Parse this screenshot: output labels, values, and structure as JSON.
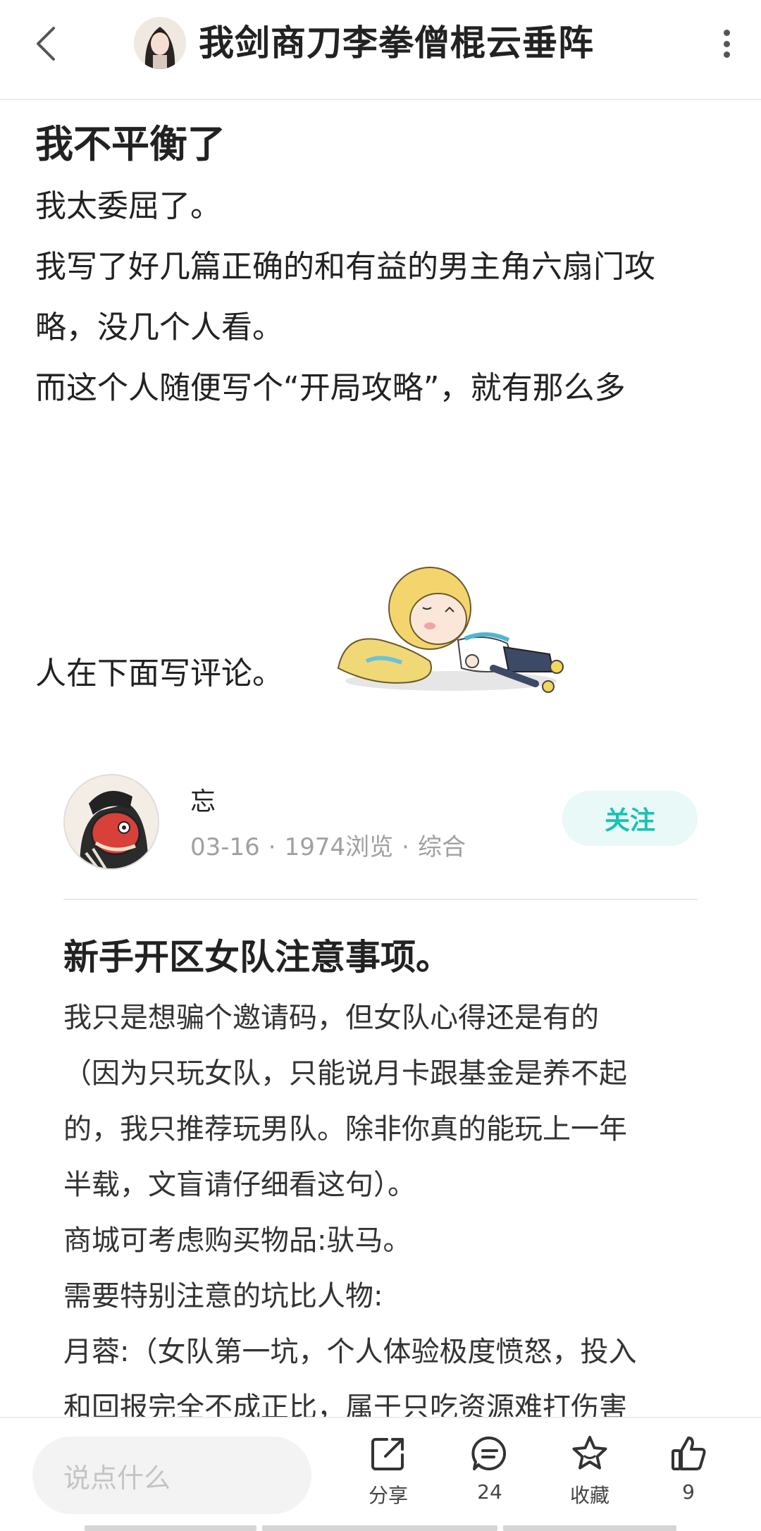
{
  "header": {
    "title": "我剑商刀李拳僧棍云垂阵"
  },
  "post": {
    "title": "我不平衡了",
    "paragraphs": [
      "我太委屈了。",
      "我写了好几篇正确的和有益的男主角六扇门攻",
      "略，没几个人看。",
      "而这个人随便写个“开局攻略”，就有那么多"
    ],
    "trailing_text": "人在下面写评论。"
  },
  "quoted_post": {
    "author": "忘",
    "date": "03-16",
    "views": "1974浏览",
    "category": "综合",
    "meta_separator": "·",
    "follow_label": "关注",
    "title": "新手开区女队注意事项。",
    "lines": [
      "我只是想骗个邀请码，但女队心得还是有的",
      "（因为只玩女队，只能说月卡跟基金是养不起",
      "的，我只推荐玩男队。除非你真的能玩上一年",
      "半载，文盲请仔细看这句）。",
      "商城可考虑购买物品:驮马。",
      "需要特别注意的坑比人物:",
      "月蓉:（女队第一坑，个人体验极度愤怒，投入",
      "和回报完全不成正比，属于只吃资源难打伤害"
    ]
  },
  "bottom_bar": {
    "comment_placeholder": "说点什么",
    "share_label": "分享",
    "comment_count": "24",
    "favorite_label": "收藏",
    "like_count": "9"
  },
  "colors": {
    "accent": "#19c2b5",
    "follow_bg": "#e8f9f7",
    "text_primary": "#222222",
    "text_meta": "#a0a0a0"
  },
  "icons": [
    "back-arrow-icon",
    "more-vertical-icon",
    "share-icon",
    "comment-icon",
    "star-icon",
    "thumbs-up-icon"
  ]
}
